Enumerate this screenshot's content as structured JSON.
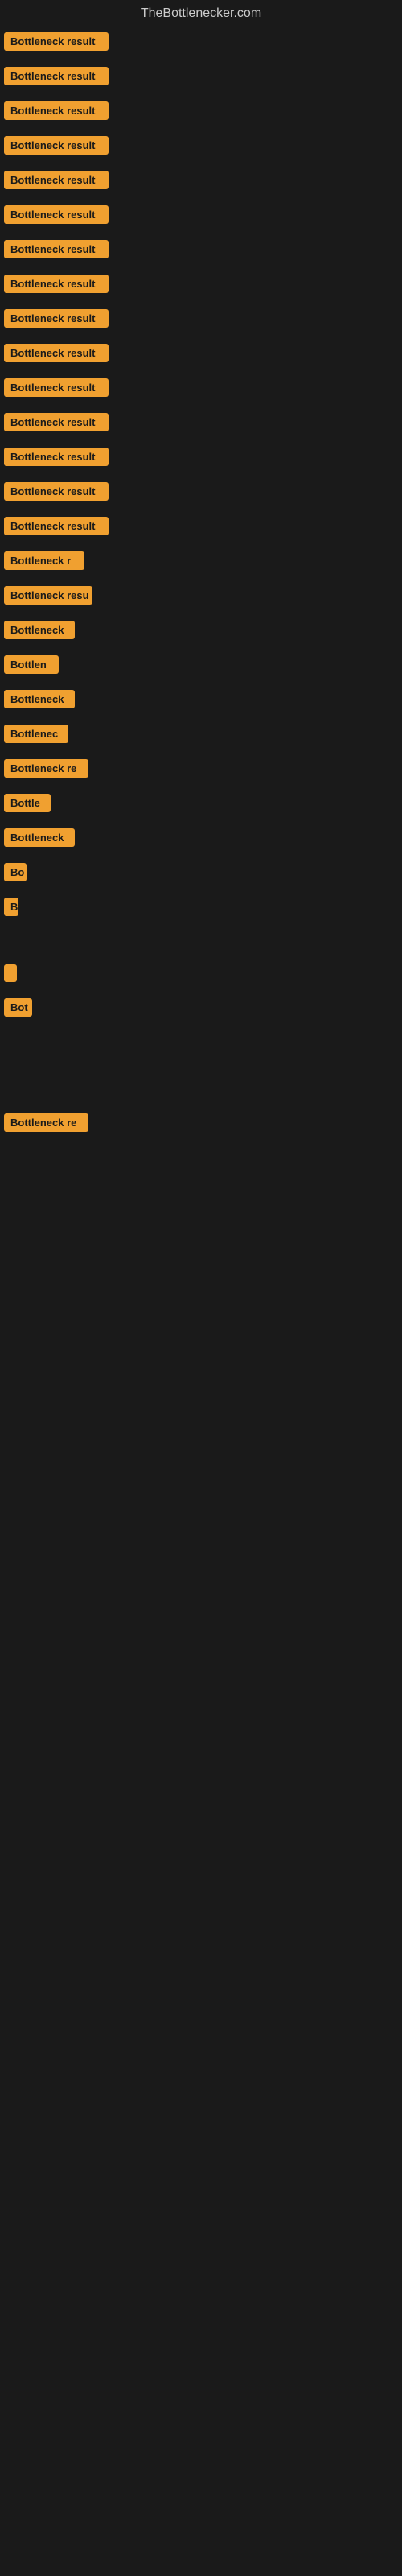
{
  "site": {
    "title": "TheBottlenecker.com"
  },
  "rows": [
    {
      "label": "Bottleneck result",
      "width": 130
    },
    {
      "label": "Bottleneck result",
      "width": 130
    },
    {
      "label": "Bottleneck result",
      "width": 130
    },
    {
      "label": "Bottleneck result",
      "width": 130
    },
    {
      "label": "Bottleneck result",
      "width": 130
    },
    {
      "label": "Bottleneck result",
      "width": 130
    },
    {
      "label": "Bottleneck result",
      "width": 130
    },
    {
      "label": "Bottleneck result",
      "width": 130
    },
    {
      "label": "Bottleneck result",
      "width": 130
    },
    {
      "label": "Bottleneck result",
      "width": 130
    },
    {
      "label": "Bottleneck result",
      "width": 130
    },
    {
      "label": "Bottleneck result",
      "width": 130
    },
    {
      "label": "Bottleneck result",
      "width": 130
    },
    {
      "label": "Bottleneck result",
      "width": 130
    },
    {
      "label": "Bottleneck result",
      "width": 130
    },
    {
      "label": "Bottleneck r",
      "width": 100
    },
    {
      "label": "Bottleneck resu",
      "width": 110
    },
    {
      "label": "Bottleneck",
      "width": 88
    },
    {
      "label": "Bottlen",
      "width": 68
    },
    {
      "label": "Bottleneck",
      "width": 88
    },
    {
      "label": "Bottlenec",
      "width": 80
    },
    {
      "label": "Bottleneck re",
      "width": 105
    },
    {
      "label": "Bottle",
      "width": 58
    },
    {
      "label": "Bottleneck",
      "width": 88
    },
    {
      "label": "Bo",
      "width": 28
    },
    {
      "label": "B",
      "width": 18
    },
    {
      "label": "",
      "width": 0
    },
    {
      "label": "",
      "width": 0
    },
    {
      "label": "",
      "width": 5
    },
    {
      "label": "Bot",
      "width": 35
    },
    {
      "label": "",
      "width": 0
    },
    {
      "label": "",
      "width": 0
    },
    {
      "label": "",
      "width": 0
    },
    {
      "label": "",
      "width": 0
    },
    {
      "label": "",
      "width": 0
    },
    {
      "label": "Bottleneck re",
      "width": 105
    },
    {
      "label": "",
      "width": 0
    },
    {
      "label": "",
      "width": 0
    },
    {
      "label": "",
      "width": 0
    }
  ],
  "colors": {
    "background": "#1a1a1a",
    "label_bg": "#f0a030",
    "label_text": "#1a1a1a",
    "title_text": "#cccccc"
  }
}
